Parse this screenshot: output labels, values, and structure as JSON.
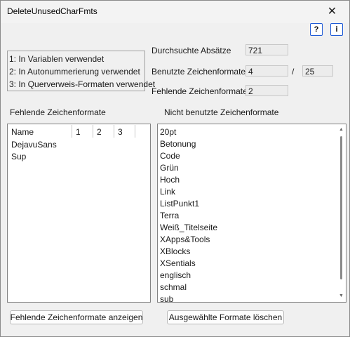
{
  "window": {
    "title": "DeleteUnusedCharFmts",
    "close_glyph": "✕"
  },
  "icons": {
    "help": "?",
    "info": "i"
  },
  "legend": [
    "1: In Variablen verwendet",
    "2: In Autonummerierung verwendet",
    "3: In Querverweis-Formaten verwendet"
  ],
  "stats": {
    "searched_label": "Durchsuchte Absätze",
    "searched_value": "721",
    "used_label": "Benutzte Zeichenformate",
    "used_value": "4",
    "separator": "/",
    "used_total": "25",
    "missing_label": "Fehlende Zeichenformate",
    "missing_value": "2"
  },
  "missing": {
    "heading": "Fehlende Zeichenformate",
    "columns": [
      "Name",
      "1",
      "2",
      "3"
    ],
    "rows": [
      "DejavuSans",
      "Sup"
    ]
  },
  "unused": {
    "heading": "Nicht benutzte Zeichenformate",
    "items": [
      "20pt",
      "Betonung",
      "Code",
      "Grün",
      "Hoch",
      "Link",
      "ListPunkt1",
      "Terra",
      "Weiß_Titelseite",
      "XApps&Tools",
      "XBlocks",
      "XSentials",
      "englisch",
      "schmal",
      "sub"
    ]
  },
  "buttons": {
    "show_missing": "Fehlende Zeichenformate anzeigen",
    "delete_selected": "Ausgewählte Formate löschen"
  }
}
